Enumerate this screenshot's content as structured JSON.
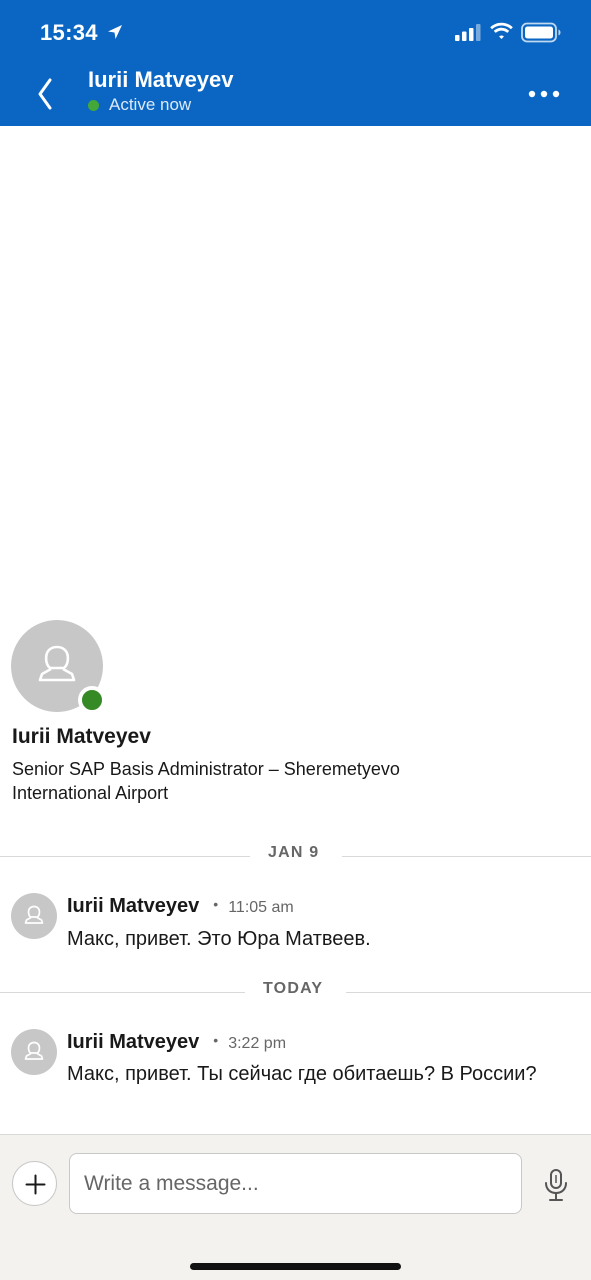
{
  "status_bar": {
    "time": "15:34"
  },
  "header": {
    "contact_name": "Iurii Matveyev",
    "presence": "Active now",
    "accent_color": "#0a66c2",
    "presence_color": "#44a839"
  },
  "profile": {
    "name": "Iurii Matveyev",
    "headline": "Senior SAP Basis Administrator – Sheremetyevo International Airport"
  },
  "conversation": {
    "groups": [
      {
        "date_label": "JAN 9",
        "messages": [
          {
            "sender": "Iurii Matveyev",
            "separator": "•",
            "time": "11:05 am",
            "text": "Макс, привет. Это Юра Матвеев."
          }
        ]
      },
      {
        "date_label": "TODAY",
        "messages": [
          {
            "sender": "Iurii Matveyev",
            "separator": "•",
            "time": "3:22 pm",
            "text": "Макс, привет. Ты сейчас где обитаешь?  В России?"
          }
        ]
      }
    ]
  },
  "composer": {
    "placeholder": "Write a message...",
    "attach_icon": "plus-icon",
    "voice_icon": "microphone-icon"
  }
}
